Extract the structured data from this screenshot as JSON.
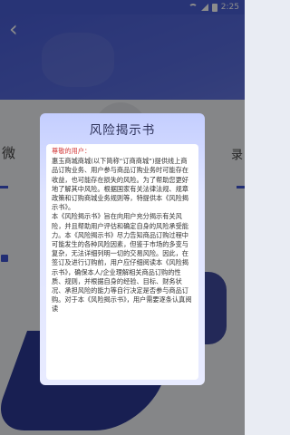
{
  "status_bar": {
    "time": "2:25"
  },
  "background_page": {
    "left_text": "微",
    "right_text": "录"
  },
  "dialog": {
    "title": "风险揭示书",
    "greeting": "尊敬的用户：",
    "paragraphs": [
      "惠玉商城商城(以下简称“订商商城”)提供线上商品订购业务、用户参与商品订购业务时可能存在收益，也可能存在损失的风险。为了帮助您更好地了解其中风险。根据国家有关法律法规、规章政策和订购商城业务规则等，特提供本《风险揭示书》。",
      "本《风险揭示书》旨在向用户充分揭示有关风险，并且帮助用户评估和确定自身的风险承受能力。本《风险揭示书》尽力告知商品订购过程中可能发生的各种风险因素，但鉴于市场的多变与复杂，无法详细列明一切的交易风险。因此，在签订及进行订购前，用户应仔细阅读本《风险揭示书》，确保本人/企业理解相关商品订购的性质、规则，并根据自身的经验、目标、财务状况、承担风险的能力等自行决定是否参与商品订购。对于本《风险揭示书》，用户需要逐条认真阅读"
    ]
  }
}
